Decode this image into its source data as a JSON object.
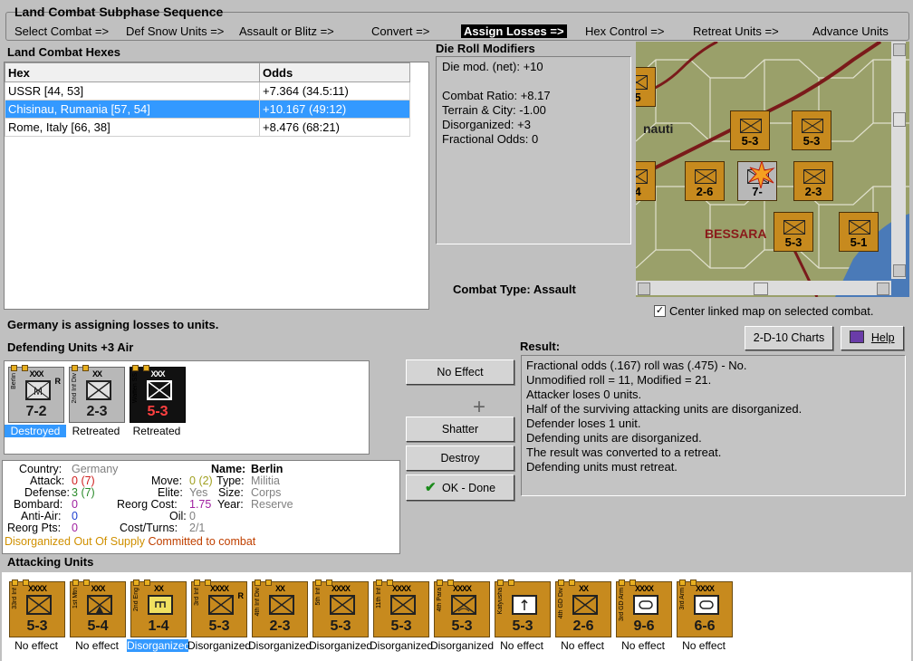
{
  "subphase": {
    "title": "Land Combat Subphase Sequence",
    "steps": [
      "Select Combat =>",
      "Def Snow Units =>",
      "Assault or Blitz =>",
      "Convert =>",
      "Assign Losses =>",
      "Hex Control =>",
      "Retreat Units =>",
      "Advance Units"
    ],
    "active_index": 4
  },
  "hexes": {
    "title": "Land Combat Hexes",
    "headers": [
      "Hex",
      "Odds"
    ],
    "rows": [
      [
        "USSR [44, 53]",
        "+7.364 (34.5:11)"
      ],
      [
        "Chisinau, Rumania [57, 54]",
        "+10.167 (49:12)"
      ],
      [
        "Rome, Italy [66, 38]",
        "+8.476 (68:21)"
      ]
    ],
    "selected_row": 1
  },
  "die": {
    "title": "Die Roll Modifiers",
    "lines": [
      "Die mod. (net): +10",
      "",
      "Combat Ratio: +8.17",
      "Terrain & City: -1.00",
      "Disorganized: +3",
      "Fractional Odds: 0"
    ]
  },
  "combat_type": {
    "label": "Combat Type:",
    "value": "Assault"
  },
  "center_map": {
    "label": "Center linked map on selected combat.",
    "checked": true
  },
  "buttons": {
    "charts": "2-D-10 Charts",
    "help": "Help",
    "no_effect": "No Effect",
    "shatter": "Shatter",
    "destroy": "Destroy",
    "ok_done": "OK - Done"
  },
  "status": "Germany is assigning losses to units.",
  "defending": {
    "title": "Defending Units +3 Air",
    "units": [
      {
        "size": "XXX",
        "strength": "7-2",
        "type": "M",
        "corner": "R",
        "name": "Berlin",
        "label": "Destroyed",
        "selected": true,
        "style": "grey"
      },
      {
        "size": "XX",
        "strength": "2-3",
        "type": "inf",
        "corner": "",
        "name": "2nd Inf Div",
        "label": "Retreated",
        "selected": false,
        "style": "grey"
      },
      {
        "size": "XXX",
        "strength": "5-3",
        "type": "inf",
        "corner": "",
        "name": "Waffen SS",
        "label": "Retreated",
        "selected": false,
        "style": "black"
      }
    ]
  },
  "info": {
    "country_label": "Country:",
    "country": "Germany",
    "attack_label": "Attack:",
    "attack": "0",
    "attack_alt": "(7)",
    "defense_label": "Defense:",
    "defense": "3",
    "defense_alt": "(7)",
    "bombard_label": "Bombard:",
    "bombard": "0",
    "antiair_label": "Anti-Air:",
    "antiair": "0",
    "reorgpts_label": "Reorg Pts:",
    "reorgpts": "0",
    "name_label": "Name:",
    "name": "Berlin",
    "move_label": "Move:",
    "move": "0",
    "move_alt": "(2)",
    "type_label": "Type:",
    "type": "Militia",
    "elite_label": "Elite:",
    "elite": "Yes",
    "size_label": "Size:",
    "size": "Corps",
    "reorg_cost_label": "Reorg Cost:",
    "reorg_cost": "1.75",
    "year_label": "Year:",
    "year": "Reserve",
    "oil_label": "Oil:",
    "oil": "0",
    "cost_label": "Cost/Turns:",
    "cost": "2/1",
    "status1": "Disorganized",
    "status2": "Out Of Supply",
    "status3": "Committed to combat"
  },
  "result": {
    "title": "Result:",
    "lines": [
      "Fractional odds (.167) roll was (.475)  - No.",
      "Unmodified roll = 11, Modified = 21.",
      "Attacker loses 0 units.",
      "Half of the surviving attacking units are disorganized.",
      "Defender loses 1 unit.",
      "Defending units are disorganized.",
      "The result was converted to a retreat.",
      "Defending units must retreat."
    ]
  },
  "attacking": {
    "title": "Attacking Units",
    "units": [
      {
        "size": "XXXX",
        "strength": "5-3",
        "type": "inf",
        "corner": "",
        "name": "33rd Inf",
        "label": "No effect",
        "selected": false
      },
      {
        "size": "XXX",
        "strength": "5-4",
        "type": "mtn",
        "corner": "",
        "name": "1st Mtn",
        "label": "No effect",
        "selected": false
      },
      {
        "size": "XX",
        "strength": "1-4",
        "type": "eng",
        "corner": "",
        "name": "2nd Eng",
        "label": "Disorganized",
        "selected": true
      },
      {
        "size": "XXXX",
        "strength": "5-3",
        "type": "inf",
        "corner": "R",
        "name": "3rd Inf",
        "label": "Disorganized",
        "selected": false
      },
      {
        "size": "XX",
        "strength": "2-3",
        "type": "inf",
        "corner": "",
        "name": "4th Inf Div",
        "label": "Disorganized",
        "selected": false
      },
      {
        "size": "XXXX",
        "strength": "5-3",
        "type": "inf",
        "corner": "",
        "name": "5th Inf",
        "label": "Disorganized",
        "selected": false
      },
      {
        "size": "XXXX",
        "strength": "5-3",
        "type": "inf",
        "corner": "",
        "name": "11th Inf",
        "label": "Disorganized",
        "selected": false
      },
      {
        "size": "XXXX",
        "strength": "5-3",
        "type": "para",
        "corner": "",
        "name": "4th Para",
        "label": "Disorganized",
        "selected": false
      },
      {
        "size": "",
        "strength": "5-3",
        "type": "rocket",
        "corner": "",
        "name": "Katyusha",
        "label": "No effect",
        "selected": false
      },
      {
        "size": "XX",
        "strength": "2-6",
        "type": "inf",
        "corner": "",
        "name": "4th GD Div",
        "label": "No effect",
        "selected": false
      },
      {
        "size": "XXXX",
        "strength": "9-6",
        "type": "arm",
        "corner": "",
        "name": "3rd GD Arm",
        "label": "No effect",
        "selected": false
      },
      {
        "size": "XXXX",
        "strength": "6-6",
        "type": "arm",
        "corner": "",
        "name": "3rd Arm",
        "label": "No effect",
        "selected": false
      }
    ]
  },
  "map": {
    "labels": [
      "nauti",
      "BESSARA"
    ],
    "counters": [
      "-5",
      "5-3",
      "5-3",
      "2-6",
      "7-",
      "2-3",
      "5-3",
      "5-1",
      "-4"
    ],
    "colors": {
      "hex": "#9aa06a",
      "river": "#7a1a1a",
      "sea": "#4a7ab8",
      "counter": "#c78a1e"
    }
  }
}
